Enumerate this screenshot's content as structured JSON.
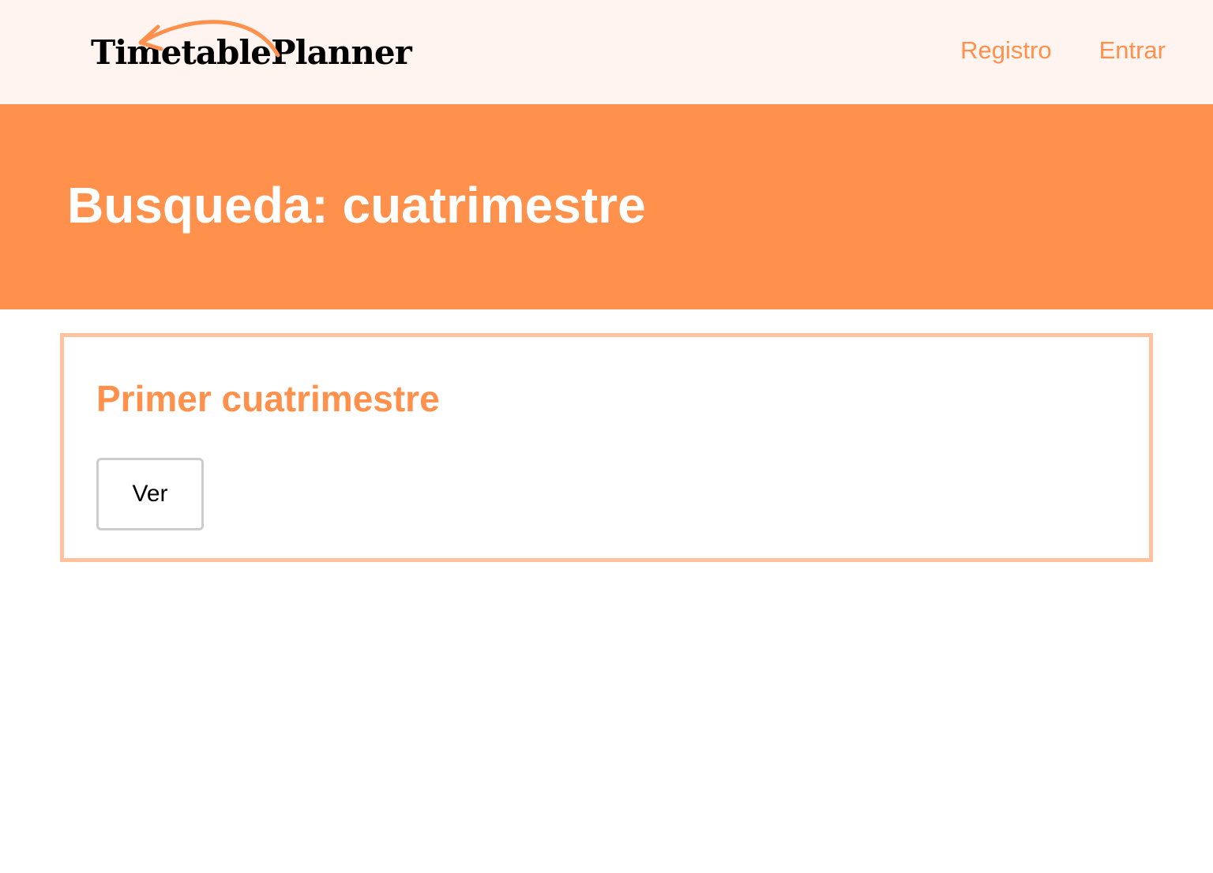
{
  "header": {
    "logo_text": "TimetablePlanner",
    "nav": [
      {
        "label": "Registro"
      },
      {
        "label": "Entrar"
      }
    ]
  },
  "hero": {
    "title": "Busqueda: cuatrimestre"
  },
  "results": [
    {
      "title": "Primer cuatrimestre",
      "button_label": "Ver"
    }
  ],
  "colors": {
    "accent": "#ff914d",
    "header_bg": "#fff4f0",
    "card_border": "#ffc19e",
    "button_border": "#cccccc"
  }
}
